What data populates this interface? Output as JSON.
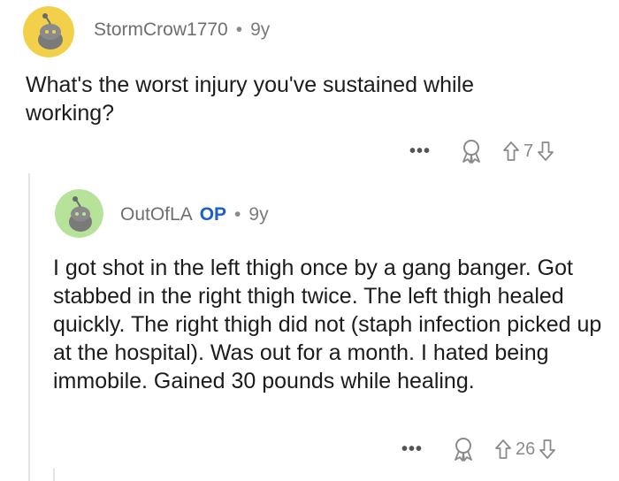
{
  "comments": [
    {
      "username": "StormCrow1770",
      "separator": "•",
      "age": "9y",
      "avatar_color": "#f2d04a",
      "avatar_icon": "snoo-avatar-icon",
      "text": "What's the worst injury you've sustained while working?",
      "more_label": "•••",
      "award_icon": "award-icon",
      "score": "7"
    },
    {
      "username": "OutOfLA",
      "op_label": "OP",
      "separator": "•",
      "age": "9y",
      "avatar_color": "#b6e29a",
      "avatar_icon": "snoo-avatar-icon",
      "text": "I got shot in the left thigh once by a gang banger. Got stabbed in the right thigh twice. The left thigh healed quickly. The right thigh did not  (staph infection picked up at the hospital). Was out for a month. I hated being immobile. Gained 30 pounds while healing.",
      "more_label": "•••",
      "award_icon": "award-icon",
      "score": "26"
    }
  ],
  "colors": {
    "op_badge": "#1d5fc9",
    "meta_text": "#7c7c7c",
    "thread_line": "#e4e4e4"
  }
}
